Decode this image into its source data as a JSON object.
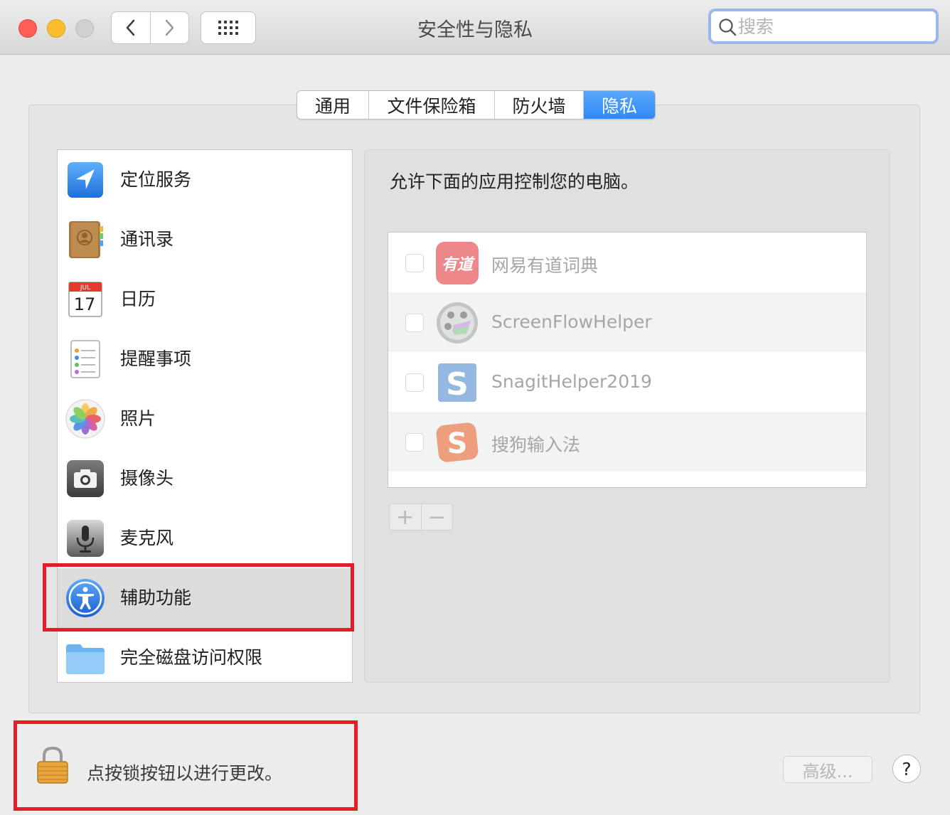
{
  "window": {
    "title": "安全性与隐私"
  },
  "search": {
    "placeholder": "搜索"
  },
  "tabs": [
    {
      "label": "通用",
      "active": false
    },
    {
      "label": "文件保险箱",
      "active": false
    },
    {
      "label": "防火墙",
      "active": false
    },
    {
      "label": "隐私",
      "active": true
    }
  ],
  "sidebar": {
    "items": [
      {
        "label": "定位服务",
        "icon": "location-arrow-icon"
      },
      {
        "label": "通讯录",
        "icon": "contacts-book-icon"
      },
      {
        "label": "日历",
        "icon": "calendar-icon",
        "calendar_month": "JUL",
        "calendar_day": "17"
      },
      {
        "label": "提醒事项",
        "icon": "reminders-icon"
      },
      {
        "label": "照片",
        "icon": "photos-icon"
      },
      {
        "label": "摄像头",
        "icon": "camera-icon"
      },
      {
        "label": "麦克风",
        "icon": "microphone-icon"
      },
      {
        "label": "辅助功能",
        "icon": "accessibility-icon",
        "selected": true
      },
      {
        "label": "完全磁盘访问权限",
        "icon": "folder-icon"
      }
    ]
  },
  "main": {
    "description": "允许下面的应用控制您的电脑。",
    "apps": [
      {
        "name": "网易有道词典",
        "checked": false,
        "icon": "youdao-icon",
        "icon_text": "有道"
      },
      {
        "name": "ScreenFlowHelper",
        "checked": false,
        "icon": "screenflow-icon"
      },
      {
        "name": "SnagitHelper2019",
        "checked": false,
        "icon": "snagit-icon",
        "icon_text": "S"
      },
      {
        "name": "搜狗输入法",
        "checked": false,
        "icon": "sogou-icon",
        "icon_text": "S"
      }
    ],
    "add_label": "+",
    "remove_label": "−"
  },
  "footer": {
    "lock_text": "点按锁按钮以进行更改。",
    "advanced_label": "高级...",
    "help_label": "?"
  },
  "colors": {
    "accent_tab": "#2f8af6",
    "highlight_box": "#e21e26",
    "search_focus_ring": "#9ab6ea"
  }
}
